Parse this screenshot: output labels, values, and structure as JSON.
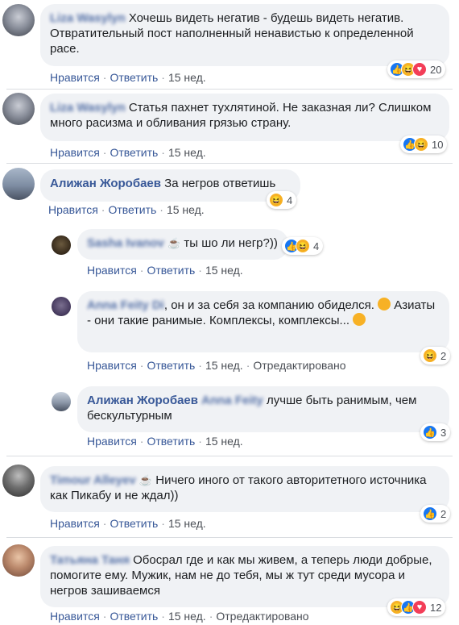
{
  "comments": [
    {
      "author": "Liza Wasylyn",
      "text": "Хочешь видеть негатив - будешь видеть негатив. Отвратительный пост наполненный ненавистью к определенной расе.",
      "like": "Нравится",
      "reply": "Ответить",
      "time": "15 нед.",
      "reactions": [
        "like",
        "haha",
        "love"
      ],
      "count": "20"
    },
    {
      "author": "Liza Wasylyn",
      "text": "Статья пахнет тухлятиной. Не заказная ли? Слишком много расизма и обливания грязью страну.",
      "like": "Нравится",
      "reply": "Ответить",
      "time": "15 нед.",
      "reactions": [
        "like",
        "haha"
      ],
      "count": "10"
    },
    {
      "author": "Алижан Жоробаев",
      "text": "За негров ответишь",
      "like": "Нравится",
      "reply": "Ответить",
      "time": "15 нед.",
      "reactions": [
        "haha"
      ],
      "count": "4"
    },
    {
      "author": "Sasha Ivanov",
      "text": "ты шо ли негр?))",
      "like": "Нравится",
      "reply": "Ответить",
      "time": "15 нед.",
      "reactions": [
        "like",
        "haha"
      ],
      "count": "4"
    },
    {
      "author": "Anna Feity Di",
      "text": ", он и за себя за компанию обиделся.",
      "text2": "Азиаты - они такие ранимые. Комплексы, комплексы...",
      "like": "Нравится",
      "reply": "Ответить",
      "time": "15 нед.",
      "edited": "Отредактировано",
      "reactions": [
        "haha"
      ],
      "count": "2"
    },
    {
      "author": "Алижан Жоробаев",
      "mention": "Anna Feity",
      "text": "лучше быть ранимым, чем бескультурным",
      "like": "Нравится",
      "reply": "Ответить",
      "time": "15 нед.",
      "reactions": [
        "like"
      ],
      "count": "3"
    },
    {
      "author": "Timour Alleyev",
      "text": "Ничего иного от такого авторитетного источника как Пикабу и не ждал))",
      "like": "Нравится",
      "reply": "Ответить",
      "time": "15 нед.",
      "reactions": [
        "like"
      ],
      "count": "2"
    },
    {
      "author": "Татьяна Таня",
      "text": "Обосрал где и как мы живем, а теперь люди добрые, помогите ему. Мужик, нам не до тебя, мы ж тут среди мусора и негров зашиваемся",
      "like": "Нравится",
      "reply": "Ответить",
      "time": "15 нед.",
      "edited": "Отредактировано",
      "reactions": [
        "haha",
        "like",
        "love"
      ],
      "count": "12"
    }
  ],
  "colors": {
    "link": "#385898",
    "bubble": "#f0f2f5",
    "like": "#1877f2",
    "haha": "#f7b125",
    "love": "#f33e58"
  }
}
